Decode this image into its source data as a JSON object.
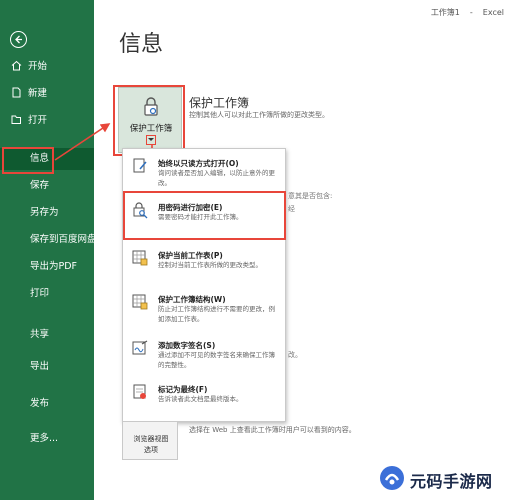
{
  "window": {
    "doc_name": "工作簿1",
    "separator": "-",
    "app_name": "Excel"
  },
  "sidebar": {
    "items": [
      {
        "label": "开始",
        "icon": "home-icon"
      },
      {
        "label": "新建",
        "icon": "new-document-icon"
      },
      {
        "label": "打开",
        "icon": "folder-open-icon"
      },
      {
        "label": "信息",
        "icon": ""
      },
      {
        "label": "保存",
        "icon": ""
      },
      {
        "label": "另存为",
        "icon": ""
      },
      {
        "label": "保存到百度网盘",
        "icon": ""
      },
      {
        "label": "导出为PDF",
        "icon": ""
      },
      {
        "label": "打印",
        "icon": ""
      },
      {
        "label": "共享",
        "icon": ""
      },
      {
        "label": "导出",
        "icon": ""
      },
      {
        "label": "发布",
        "icon": ""
      },
      {
        "label": "更多...",
        "icon": ""
      }
    ],
    "active_item": "信息"
  },
  "page": {
    "title": "信息"
  },
  "protect": {
    "button_label": "保护工作簿",
    "heading": "保护工作簿",
    "description": "控制其他人可以对此工作簿所做的更改类型。"
  },
  "background_fragments": {
    "f1": "意其是否包含:",
    "f2": "经",
    "f3": "改。"
  },
  "menu": {
    "items": [
      {
        "title": "始终以只读方式打开(O)",
        "desc": "询问读者是否加入编辑，以防止意外的更改。"
      },
      {
        "title": "用密码进行加密(E)",
        "desc": "需要密码才能打开此工作簿。"
      },
      {
        "title": "保护当前工作表(P)",
        "desc": "控制对当前工作表所做的更改类型。"
      },
      {
        "title": "保护工作簿结构(W)",
        "desc": "防止对工作簿结构进行不需要的更改，例如添加工作表。"
      },
      {
        "title": "添加数字签名(S)",
        "desc": "通过添加不可见的数字签名来确保工作簿的完整性。"
      },
      {
        "title": "标记为最终(F)",
        "desc": "告诉读者此文档是最终版本。"
      }
    ]
  },
  "browser_view": {
    "line1": "浏览器视图",
    "line2": "选项",
    "description": "选择在 Web 上查看此工作簿时用户可以看到的内容。"
  },
  "watermark": {
    "text": "元码手游网"
  },
  "colors": {
    "sidebar": "#217346",
    "highlight": "#e8463a",
    "accent": "#2e6fbd"
  }
}
